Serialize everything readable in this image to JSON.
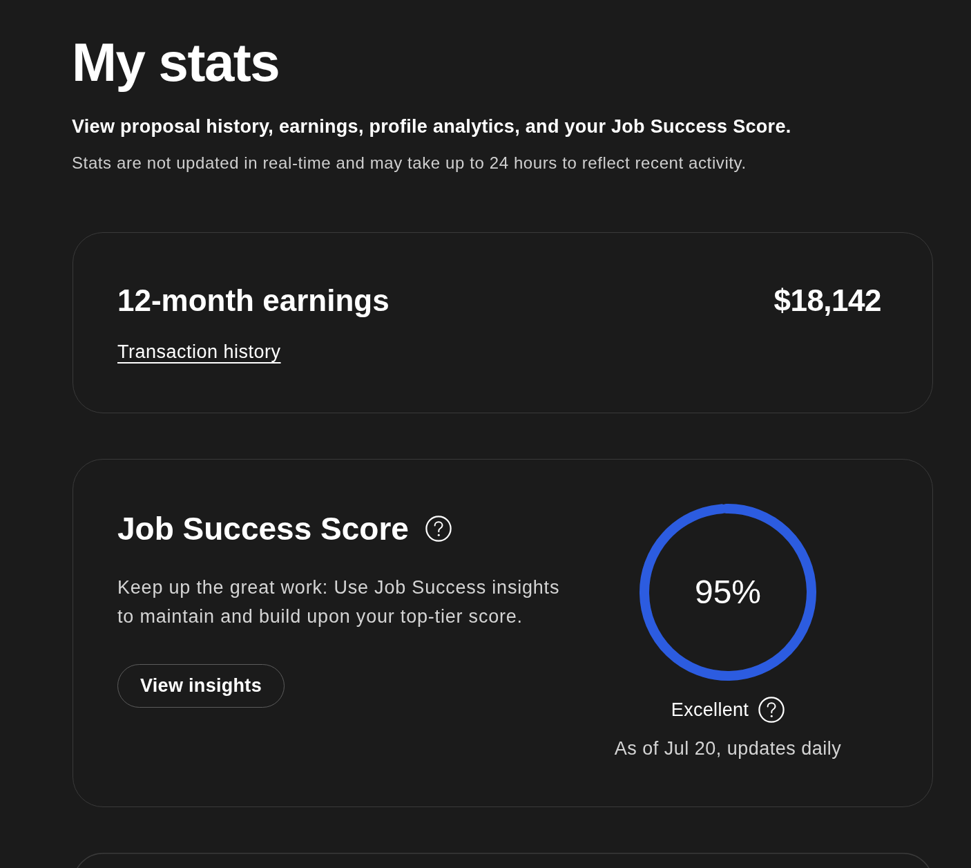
{
  "page": {
    "title": "My stats",
    "subtitle": "View proposal history, earnings, profile analytics, and your Job Success Score.",
    "note": "Stats are not updated in real-time and may take up to 24 hours to reflect recent activity."
  },
  "earnings_card": {
    "title": "12-month earnings",
    "amount": "$18,142",
    "link": "Transaction history"
  },
  "job_success_card": {
    "title": "Job Success Score",
    "description": "Keep up the great work: Use Job Success insights to maintain and build upon your top-tier score.",
    "button": "View insights",
    "score": {
      "value": "95%",
      "level": 0.99,
      "rating": "Excellent",
      "updated": "As of Jul 20, updates daily"
    }
  }
}
